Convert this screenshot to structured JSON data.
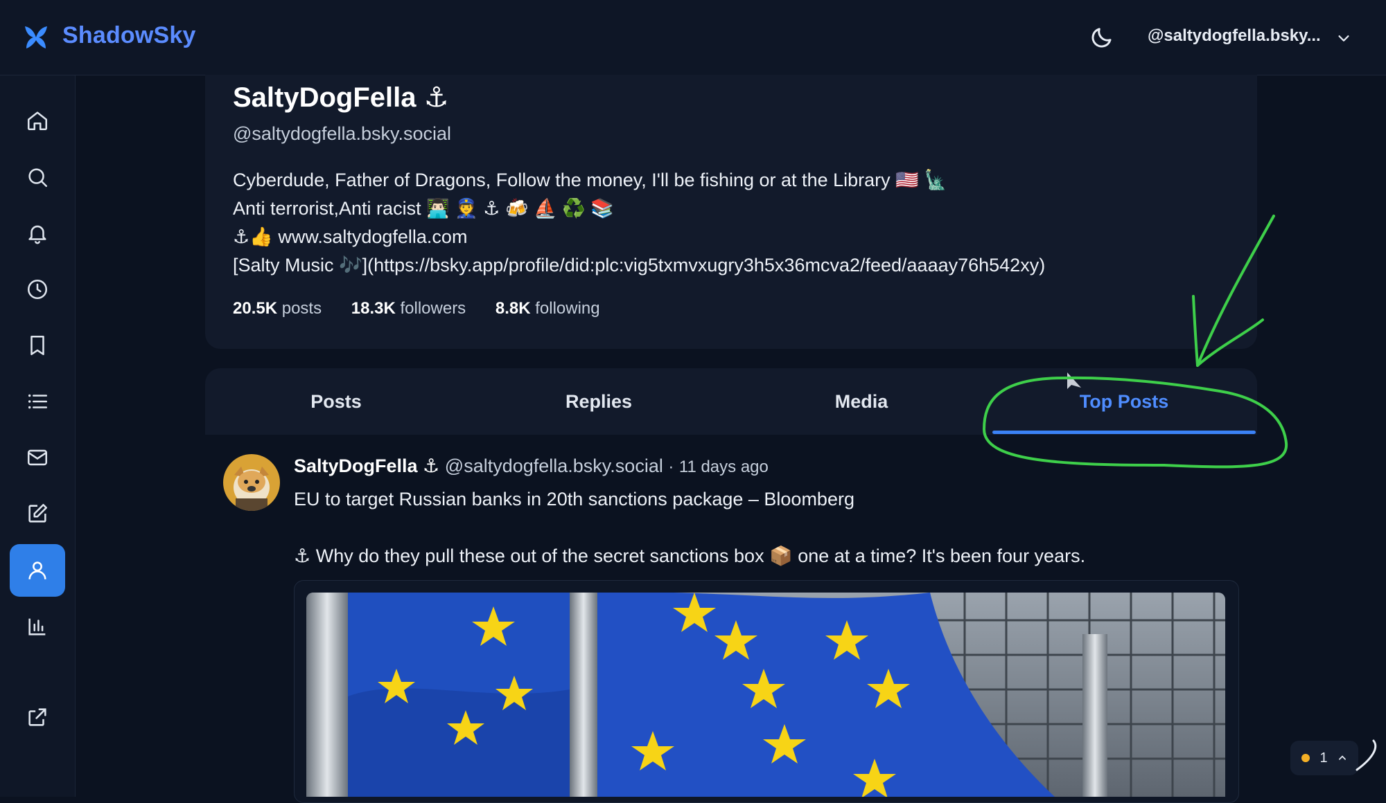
{
  "app": {
    "brand": "ShadowSky",
    "account": "@saltydogfella.bsky..."
  },
  "colors": {
    "accent": "#3b82f6",
    "brand": "#5b8cff",
    "active_nav": "#2f7fe8",
    "annotation": "#3ecf4a",
    "status_dot": "#f5b026"
  },
  "sidebar": {
    "items": [
      {
        "name": "home",
        "icon": "home-icon"
      },
      {
        "name": "search",
        "icon": "search-icon"
      },
      {
        "name": "notifications",
        "icon": "bell-icon"
      },
      {
        "name": "history",
        "icon": "clock-icon"
      },
      {
        "name": "bookmarks",
        "icon": "bookmark-icon"
      },
      {
        "name": "lists",
        "icon": "list-icon"
      },
      {
        "name": "messages",
        "icon": "mail-icon"
      },
      {
        "name": "compose",
        "icon": "edit-icon"
      },
      {
        "name": "profile",
        "icon": "user-icon",
        "active": true
      },
      {
        "name": "analytics",
        "icon": "bar-chart-icon"
      },
      {
        "name": "external",
        "icon": "external-link-icon"
      }
    ]
  },
  "profile": {
    "name": "SaltyDogFella ⚓",
    "handle": "@saltydogfella.bsky.social",
    "bio": [
      "Cyberdude, Father of Dragons, Follow the money, I'll be fishing or at the Library 🇺🇸 🗽",
      "Anti terrorist,Anti racist 👨🏻‍💻 👮 ⚓ 🍻 ⛵ ♻️ 📚",
      "⚓👍 www.saltydogfella.com",
      "[Salty Music 🎶](https://bsky.app/profile/did:plc:vig5txmvxugry3h5x36mcva2/feed/aaaay76h542xy)"
    ],
    "stats": {
      "posts_count": "20.5K",
      "posts_label": "posts",
      "followers_count": "18.3K",
      "followers_label": "followers",
      "following_count": "8.8K",
      "following_label": "following"
    }
  },
  "tabs": [
    {
      "label": "Posts"
    },
    {
      "label": "Replies"
    },
    {
      "label": "Media"
    },
    {
      "label": "Top Posts",
      "active": true
    }
  ],
  "post": {
    "author": "SaltyDogFella ⚓",
    "handle": "@saltydogfella.bsky.social",
    "separator": "·",
    "time": "11 days ago",
    "line1": "EU to target Russian banks in 20th sanctions package – Bloomberg",
    "line2": "⚓ Why do they pull these out of the secret sanctions box 📦 one at a time? It's been four years."
  },
  "status": {
    "count": "1"
  }
}
